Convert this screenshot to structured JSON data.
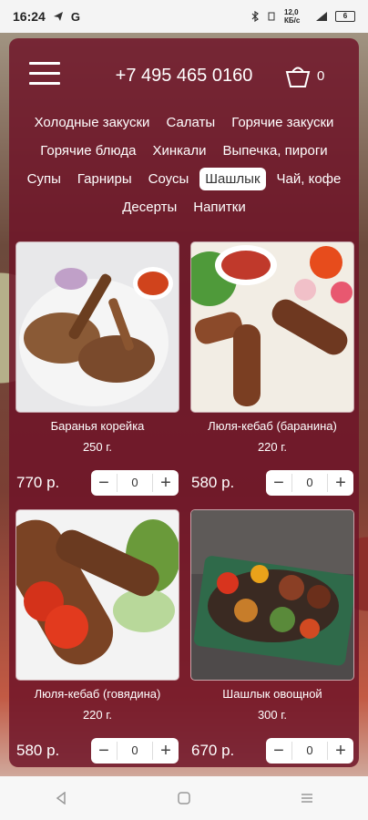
{
  "status": {
    "time": "16:24",
    "app_icons": [
      "telegram-icon",
      "g-icon"
    ],
    "net_speed": "12,0 КБ/с",
    "battery": "6"
  },
  "header": {
    "phone": "+7 495 465 0160",
    "cart_count": "0"
  },
  "categories": [
    [
      "Холодные закуски",
      "Салаты",
      "Горячие закуски"
    ],
    [
      "Горячие блюда",
      "Хинкали",
      "Выпечка, пироги"
    ],
    [
      "Супы",
      "Гарниры",
      "Соусы",
      "Шашлык",
      "Чай, кофе"
    ],
    [
      "Десерты",
      "Напитки"
    ]
  ],
  "active_category": "Шашлык",
  "products": [
    {
      "name": "Баранья корейка",
      "weight": "250 г.",
      "price": "770 р.",
      "qty": "0"
    },
    {
      "name": "Люля-кебаб (баранина)",
      "weight": "220 г.",
      "price": "580 р.",
      "qty": "0"
    },
    {
      "name": "Люля-кебаб (говядина)",
      "weight": "220 г.",
      "price": "580 р.",
      "qty": "0"
    },
    {
      "name": "Шашлык овощной",
      "weight": "300 г.",
      "price": "670 р.",
      "qty": "0"
    }
  ],
  "stepper": {
    "minus": "−",
    "plus": "+"
  },
  "colors": {
    "panel": "#6e1428",
    "active_tab_bg": "#ffffff"
  }
}
